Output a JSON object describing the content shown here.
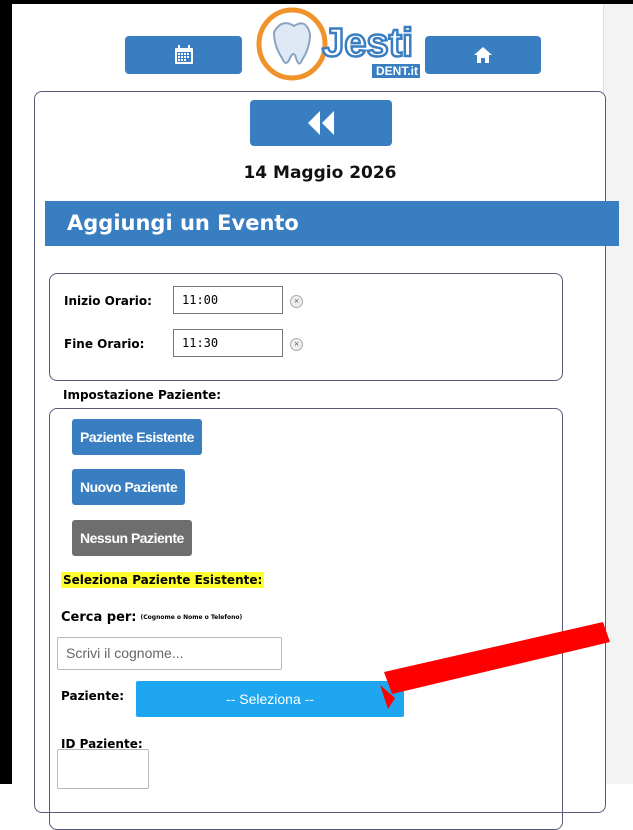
{
  "header": {
    "calendar_icon": "calendar-icon",
    "home_icon": "home-icon",
    "logo_text": "Jesti",
    "logo_sub": "DENT.it"
  },
  "panel": {
    "back_icon": "double-chevron-left-icon",
    "date": "14 Maggio 2026",
    "title": "Aggiungi un Evento"
  },
  "time": {
    "start_label": "Inizio Orario:",
    "start_value": "11:00",
    "end_label": "Fine Orario:",
    "end_value": "11:30",
    "clear_glyph": "×"
  },
  "patient": {
    "section_label": "Impostazione Paziente:",
    "existing_button": "Paziente Esistente",
    "new_button": "Nuovo Paziente",
    "none_button": "Nessun Paziente",
    "select_existing_heading": "Seleziona Paziente Esistente:",
    "search_label": "Cerca per:",
    "search_hint": "(Cognome o Nome o Telefono)",
    "search_placeholder": "Scrivi il cognome...",
    "patient_label": "Paziente:",
    "patient_select": "-- Seleziona --",
    "id_label": "ID Paziente:"
  },
  "colors": {
    "primary": "#3a7ec2",
    "select": "#1fa6f0",
    "neutral_button": "#6e6e6e",
    "highlight": "#ffff2e",
    "annotation_arrow": "#ff0000"
  }
}
